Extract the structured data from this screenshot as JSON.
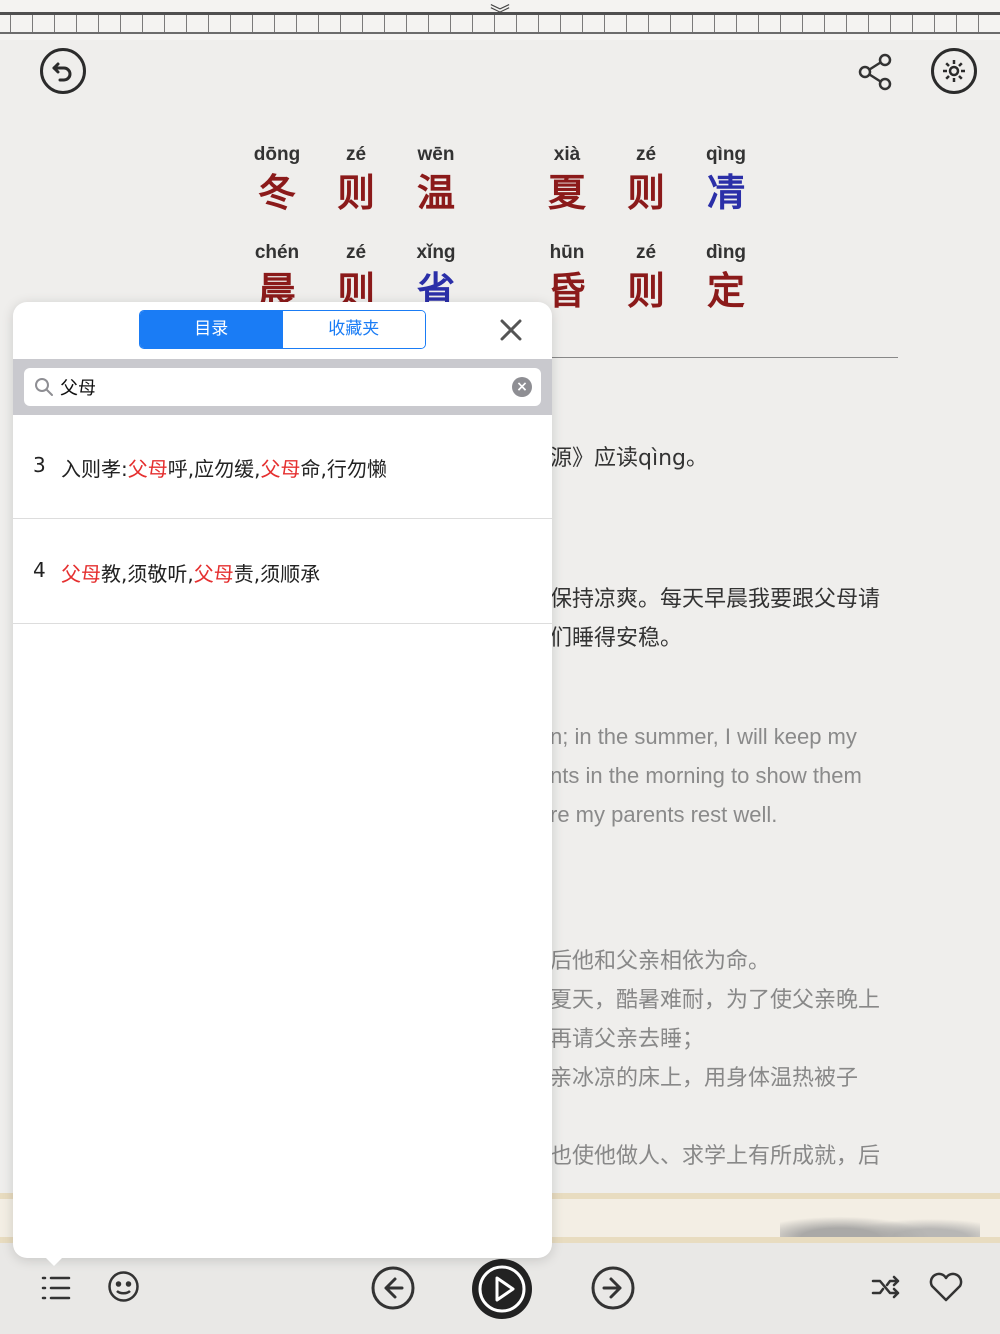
{
  "top_notch": "︾",
  "verse": {
    "row1": [
      {
        "py": "dōng",
        "hz": "冬",
        "blue": false
      },
      {
        "py": "zé",
        "hz": "则",
        "blue": false
      },
      {
        "py": "wēn",
        "hz": "温",
        "blue": false
      },
      {
        "py": "xià",
        "hz": "夏",
        "blue": false
      },
      {
        "py": "zé",
        "hz": "则",
        "blue": false
      },
      {
        "py": "qìng",
        "hz": "凊",
        "blue": true
      }
    ],
    "row2": [
      {
        "py": "chén",
        "hz": "晨",
        "blue": false
      },
      {
        "py": "zé",
        "hz": "则",
        "blue": false
      },
      {
        "py": "xǐng",
        "hz": "省",
        "blue": true
      },
      {
        "py": "hūn",
        "hz": "昏",
        "blue": false
      },
      {
        "py": "zé",
        "hz": "则",
        "blue": false
      },
      {
        "py": "dìng",
        "hz": "定",
        "blue": false
      }
    ]
  },
  "background_text": {
    "note": "源》应读qìng。",
    "cn1": "保持凉爽。每天早晨我要跟父母请",
    "cn2": "们睡得安稳。",
    "en1": "n; in the summer, I will keep my",
    "en2": "nts in the morning to show them",
    "en3": "re my parents rest well.",
    "story1": "后他和父亲相依为命。",
    "story2": "夏天，酷暑难耐，为了使父亲晚上",
    "story3": "再请父亲去睡；",
    "story4": "亲冰凉的床上，用身体温热被子",
    "story5": "也使他做人、求学上有所成就，后"
  },
  "popover": {
    "tabs": [
      "目录",
      "收藏夹"
    ],
    "active_tab": 0,
    "search": {
      "value": "父母",
      "placeholder": ""
    },
    "results": [
      {
        "num": "3",
        "parts": [
          [
            "入则孝:",
            false
          ],
          [
            "父母",
            true
          ],
          [
            "呼,应勿缓,",
            false
          ],
          [
            "父母",
            true
          ],
          [
            "命,行勿懒",
            false
          ]
        ]
      },
      {
        "num": "4",
        "parts": [
          [
            "父母",
            true
          ],
          [
            "教,须敬听,",
            false
          ],
          [
            "父母",
            true
          ],
          [
            "责,须顺承",
            false
          ]
        ]
      }
    ]
  },
  "colors": {
    "accent": "#1a7cf5",
    "highlight": "#e53030",
    "hanzi_red": "#8b1a1a",
    "hanzi_blue": "#2b2fa8"
  },
  "icons": {
    "back": "back-arrow-icon",
    "share": "share-icon",
    "settings": "gear-icon",
    "toc": "list-icon",
    "face": "face-icon",
    "prev": "prev-arrow-icon",
    "play": "play-icon",
    "next": "next-arrow-icon",
    "shuffle": "shuffle-icon",
    "favorite": "heart-icon"
  }
}
